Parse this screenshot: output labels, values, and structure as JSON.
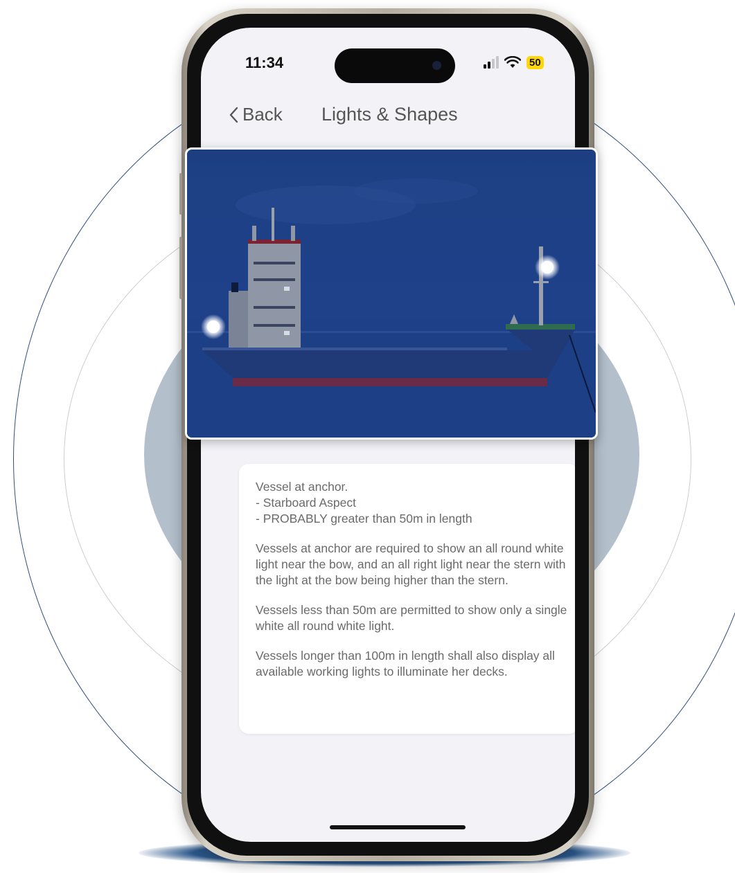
{
  "status_bar": {
    "time": "11:34",
    "battery": "50",
    "icons": [
      "signal-icon",
      "wifi-icon",
      "battery-icon"
    ]
  },
  "nav": {
    "back_label": "Back",
    "back_icon": "chevron-left-icon",
    "title": "Lights & Shapes"
  },
  "illustration": {
    "description_icon": "vessel-at-anchor-image",
    "colors": {
      "sky": "#1f418a",
      "hull": "#203a78",
      "light": "#ffffff"
    }
  },
  "description": {
    "heading": "Vessel at anchor.",
    "bullets": [
      "- Starboard Aspect",
      "- PROBABLY greater than 50m in length"
    ],
    "paragraphs": [
      "Vessels at anchor are required to show an all round white light near the bow, and an all right light near the stern with the light at the bow being higher than the stern.",
      "Vessels less than 50m are permitted to show only a single white all round white light.",
      "Vessels longer than 100m in length shall also display all available working lights to illuminate her decks."
    ]
  },
  "colors": {
    "accent": "#2e4f7c",
    "ring_fill": "#b3bfcb",
    "screen_bg": "#f2f2f7"
  }
}
